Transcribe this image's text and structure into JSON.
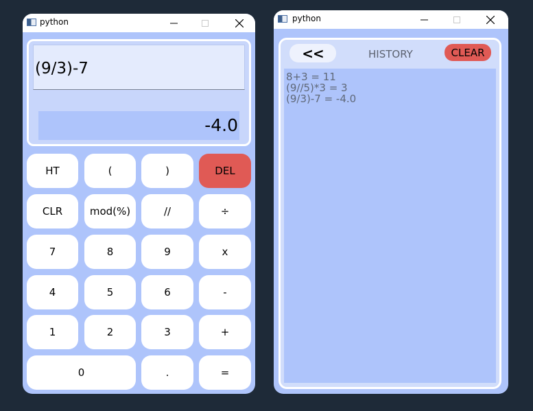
{
  "calculator_window": {
    "title": "python",
    "expression": "(9/3)-7",
    "result": "-4.0",
    "buttons": {
      "ht": "HT",
      "lparen": "(",
      "rparen": ")",
      "del": "DEL",
      "clr": "CLR",
      "mod": "mod(%)",
      "floordiv": "//",
      "div": "÷",
      "seven": "7",
      "eight": "8",
      "nine": "9",
      "mul": "x",
      "four": "4",
      "five": "5",
      "six": "6",
      "minus": "-",
      "one": "1",
      "two": "2",
      "three": "3",
      "plus": "+",
      "zero": "0",
      "dot": ".",
      "equals": "="
    }
  },
  "history_window": {
    "title": "python",
    "back_label": "<<",
    "heading": "HISTORY",
    "clear_label": "CLEAR",
    "entries": [
      "8+3 = 11",
      "(9//5)*3 = 3",
      "(9/3)-7 = -4.0"
    ]
  },
  "colors": {
    "desktop": "#1e2a38",
    "window_body": "#aec4fb",
    "danger": "#e05a55"
  },
  "icons": {
    "app": "python-app-icon",
    "minimize": "minimize-icon",
    "maximize": "maximize-icon",
    "close": "close-icon"
  }
}
